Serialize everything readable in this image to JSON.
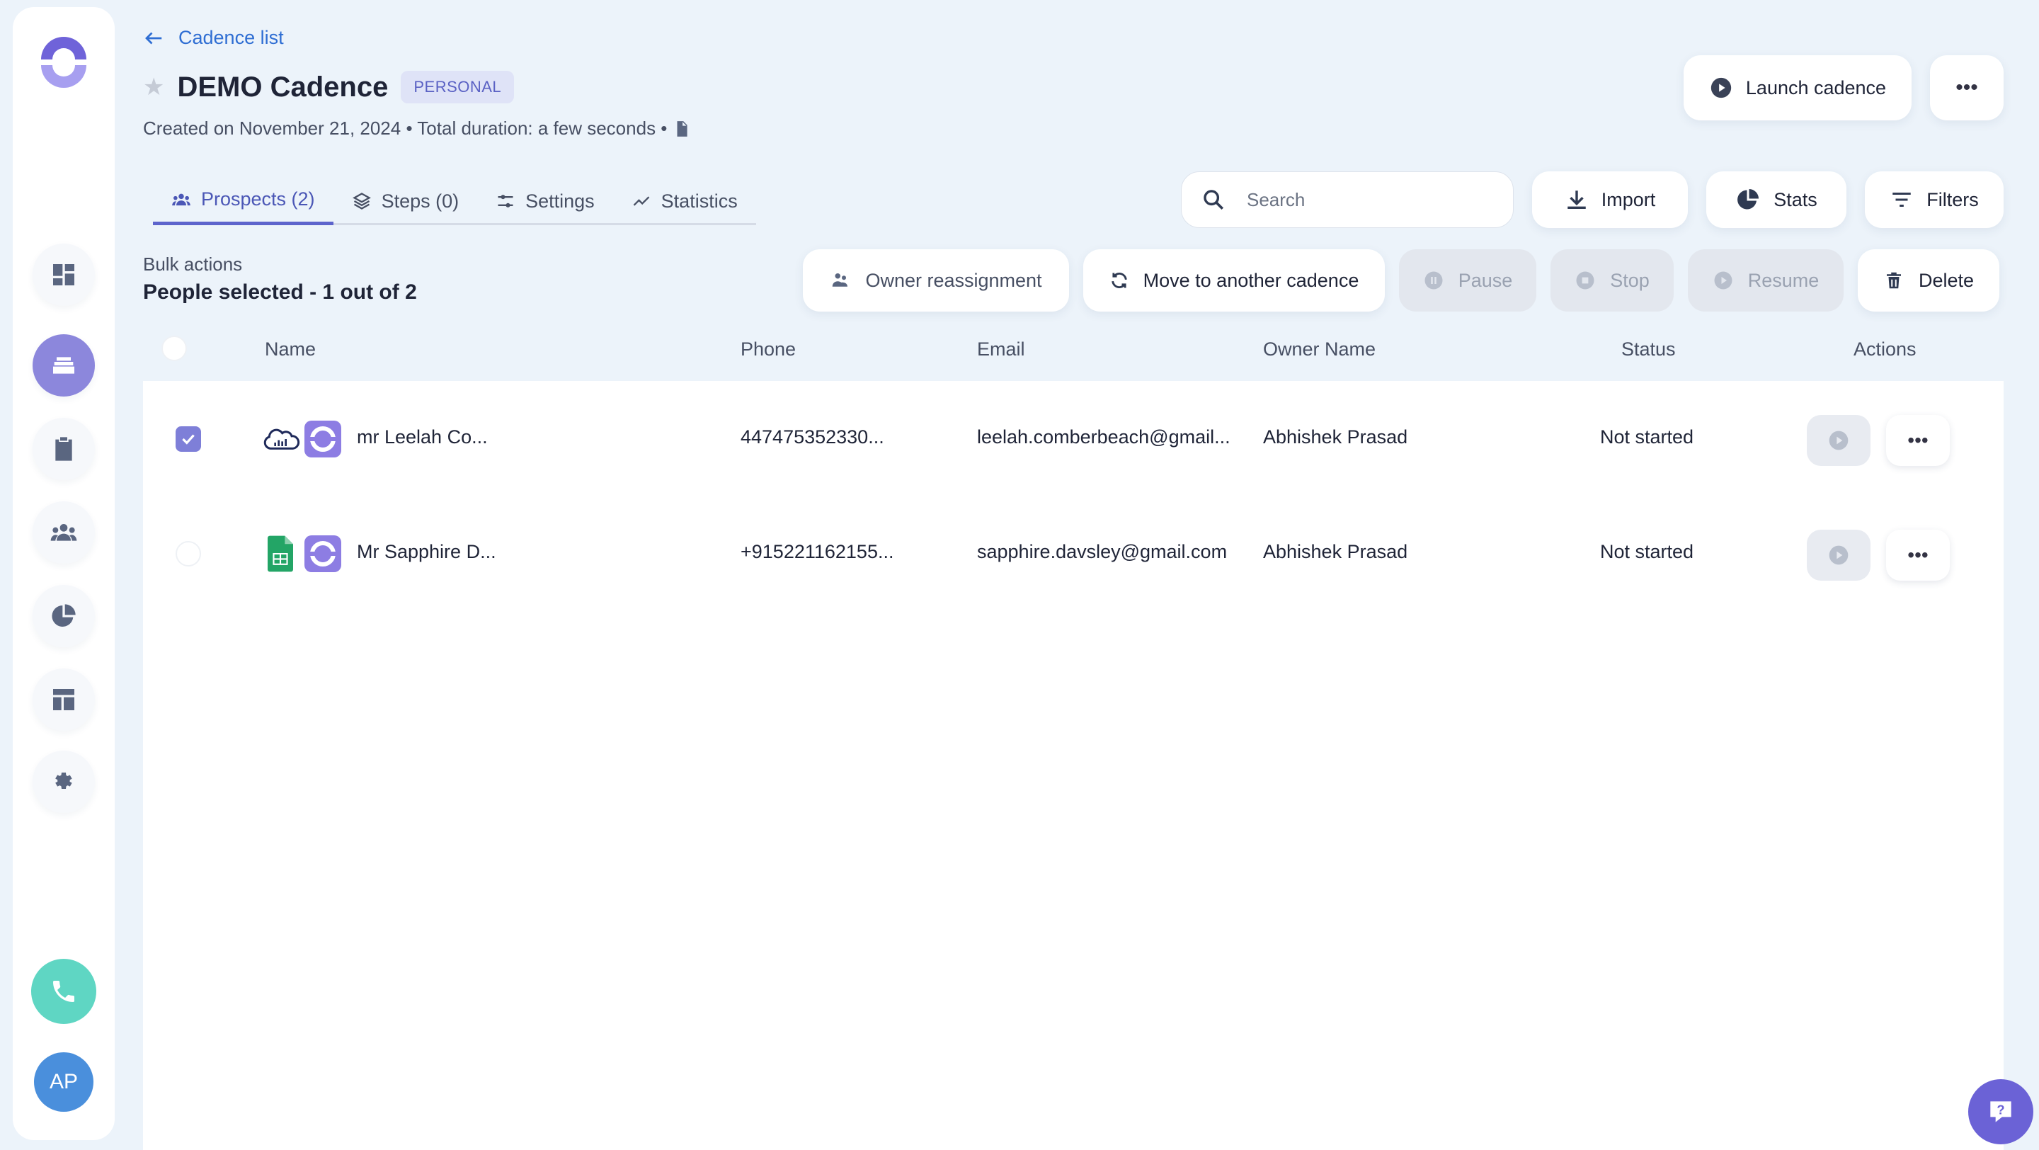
{
  "sidebar": {
    "items": [
      {
        "icon": "dashboard-icon"
      },
      {
        "icon": "cadences-icon",
        "active": true
      },
      {
        "icon": "tasks-icon"
      },
      {
        "icon": "people-icon"
      },
      {
        "icon": "reports-icon"
      },
      {
        "icon": "templates-icon"
      },
      {
        "icon": "settings-icon"
      }
    ],
    "avatar_initials": "AP"
  },
  "header": {
    "back_label": "Cadence list",
    "title": "DEMO Cadence",
    "badge": "PERSONAL",
    "meta": "Created on November 21, 2024 • Total duration: a few seconds •",
    "launch_label": "Launch cadence"
  },
  "tabs": [
    {
      "label": "Prospects (2)",
      "active": true
    },
    {
      "label": "Steps (0)"
    },
    {
      "label": "Settings"
    },
    {
      "label": "Statistics"
    }
  ],
  "toolbar": {
    "search_placeholder": "Search",
    "import_label": "Import",
    "stats_label": "Stats",
    "filters_label": "Filters"
  },
  "bulk": {
    "label": "Bulk actions",
    "count": "People selected - 1 out of 2",
    "owner_reassignment": "Owner reassignment",
    "move": "Move to another cadence",
    "pause": "Pause",
    "stop": "Stop",
    "resume": "Resume",
    "delete": "Delete"
  },
  "table": {
    "columns": [
      "Name",
      "Phone",
      "Email",
      "Owner Name",
      "Status",
      "Actions"
    ],
    "rows": [
      {
        "selected": true,
        "source": "salesforce",
        "name": "mr Leelah Co...",
        "phone": "447475352330...",
        "email": "leelah.comberbeach@gmail...",
        "owner": "Abhishek Prasad",
        "status": "Not started"
      },
      {
        "selected": false,
        "source": "google-sheets",
        "name": "Mr Sapphire D...",
        "phone": "+915221162155...",
        "email": "sapphire.davsley@gmail.com",
        "owner": "Abhishek Prasad",
        "status": "Not started"
      }
    ]
  },
  "colors": {
    "accent": "#5d64cc",
    "link": "#2f6ed3",
    "background": "#ecf3fa",
    "phone_button": "#5fd6c3",
    "avatar": "#4a8fdc"
  }
}
